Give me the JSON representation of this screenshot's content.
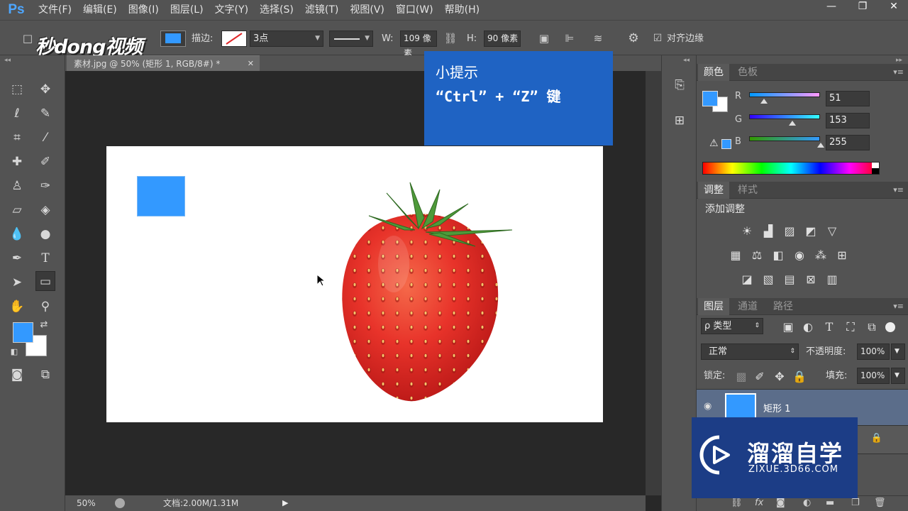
{
  "app": {
    "logo": "Ps"
  },
  "menu": [
    "文件(F)",
    "编辑(E)",
    "图像(I)",
    "图层(L)",
    "文字(Y)",
    "选择(S)",
    "滤镜(T)",
    "视图(V)",
    "窗口(W)",
    "帮助(H)"
  ],
  "window_controls": [
    "—",
    "❐",
    "✕"
  ],
  "options": {
    "stroke_label": "描边:",
    "stroke_width": "3点",
    "w_label": "W:",
    "w_value": "109 像素",
    "h_label": "H:",
    "h_value": "90 像素",
    "align_edges": "对齐边缘",
    "fill_color": "#3399ff"
  },
  "watermark_logo": "秒dong视频",
  "document": {
    "tab_title": "素材.jpg @ 50% (矩形 1, RGB/8#) *",
    "tab_close": "✕",
    "zoom": "50%",
    "doc_size": "文档:2.00M/1.31M"
  },
  "tip": {
    "title": "小提示",
    "text": "“Ctrl” + “Z” 键"
  },
  "color_panel": {
    "tabs": [
      "颜色",
      "色板"
    ],
    "channels": [
      {
        "label": "R",
        "value": "51",
        "level": 0.2
      },
      {
        "label": "G",
        "value": "153",
        "level": 0.6
      },
      {
        "label": "B",
        "value": "255",
        "level": 1.0
      }
    ],
    "fg_color": "#3399ff",
    "bg_color": "#ffffff"
  },
  "adjust_panel": {
    "tabs": [
      "调整",
      "样式"
    ],
    "title": "添加调整"
  },
  "layers_panel": {
    "tabs": [
      "图层",
      "通道",
      "路径"
    ],
    "filter_type": "ρ 类型",
    "blend_mode": "正常",
    "opacity_label": "不透明度:",
    "opacity_value": "100%",
    "lock_label": "锁定:",
    "fill_label": "填充:",
    "fill_value": "100%",
    "layers": [
      {
        "name": "矩形 1"
      }
    ]
  },
  "brand": {
    "name": "溜溜自学",
    "url": "ZIXUE.3D66.COM"
  }
}
